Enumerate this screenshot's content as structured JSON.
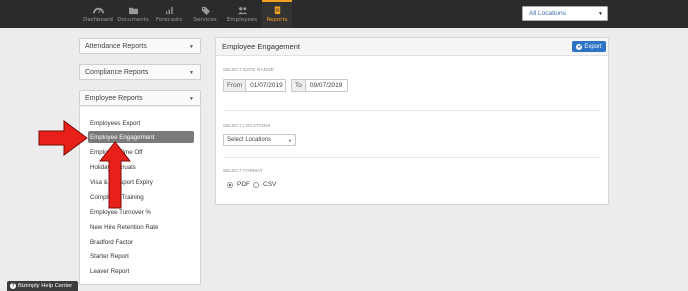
{
  "nav": {
    "items": [
      {
        "label": "Dashboard",
        "icon": "dashboard-icon"
      },
      {
        "label": "Documents",
        "icon": "folder-icon"
      },
      {
        "label": "Forecasts",
        "icon": "bar-chart-icon"
      },
      {
        "label": "Services",
        "icon": "tag-icon"
      },
      {
        "label": "Employees",
        "icon": "people-icon"
      },
      {
        "label": "Reports",
        "icon": "reports-icon"
      }
    ],
    "active": "Reports",
    "location_selector": "All Locations"
  },
  "sidebar": {
    "sections": [
      {
        "label": "Attendance Reports"
      },
      {
        "label": "Compliance Reports"
      },
      {
        "label": "Employee Reports"
      }
    ],
    "employee_reports": [
      "Employees Export",
      "Employee Engagement",
      "Employee Time Off",
      "Holiday Accruals",
      "Visa & Passport Expiry",
      "Completed Training",
      "Employee Turnover %",
      "New Hire Retention Rate",
      "Bradford Factor",
      "Starter Report",
      "Leaver Report"
    ],
    "selected_report": "Employee Engagement"
  },
  "panel": {
    "title": "Employee Engagement",
    "export_label": "Export",
    "date_range_label": "SELECT DATE RANGE",
    "from_label": "From",
    "from_value": "01/07/2019",
    "to_label": "To",
    "to_value": "09/07/2019",
    "locations_label": "SELECT LOCATIONS",
    "locations_placeholder": "Select Locations",
    "format_label": "SELECT FORMAT",
    "formats": [
      "PDF",
      "CSV"
    ],
    "selected_format": "PDF"
  },
  "help": {
    "label": "Bizimply Help Center"
  },
  "colors": {
    "topbar": "#2b2b2b",
    "active_nav": "#f0a020",
    "primary_button": "#2d72c4",
    "annotation_arrow": "#e8201a"
  }
}
